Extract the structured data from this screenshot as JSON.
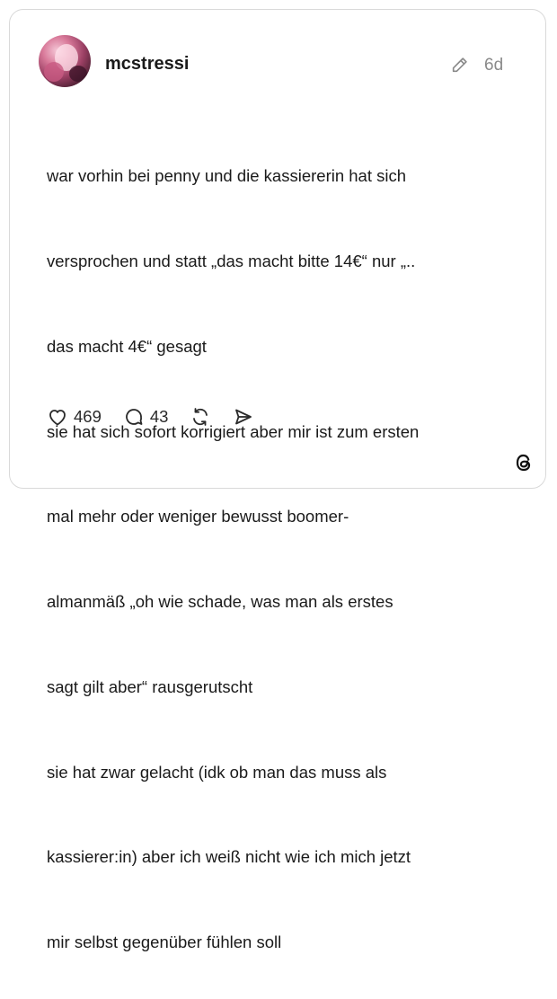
{
  "post": {
    "username": "mcstressi",
    "time": "6d",
    "lines": [
      "war vorhin bei penny und die kassiererin hat sich",
      "versprochen und statt „das macht bitte 14€“ nur „..",
      "das macht 4€“ gesagt",
      "sie hat sich sofort korrigiert aber mir ist zum ersten",
      "mal mehr oder weniger bewusst boomer-",
      "almanmäß „oh wie schade, was man als erstes",
      "sagt gilt aber“ rausgerutscht",
      "sie hat zwar gelacht (idk ob man das muss als",
      "kassierer:in) aber ich weiß nicht wie ich mich jetzt",
      "mir selbst gegenüber fühlen soll"
    ]
  },
  "actions": {
    "likes": "469",
    "replies": "43"
  },
  "icons": {
    "edit": "pencil-icon",
    "like": "heart-icon",
    "reply": "comment-bubble-icon",
    "repost": "repost-icon",
    "share": "send-icon",
    "brand": "threads-logo-icon"
  },
  "colors": {
    "text": "#1a1a1a",
    "muted": "#8a8a8a",
    "border": "#d9d9d9"
  }
}
